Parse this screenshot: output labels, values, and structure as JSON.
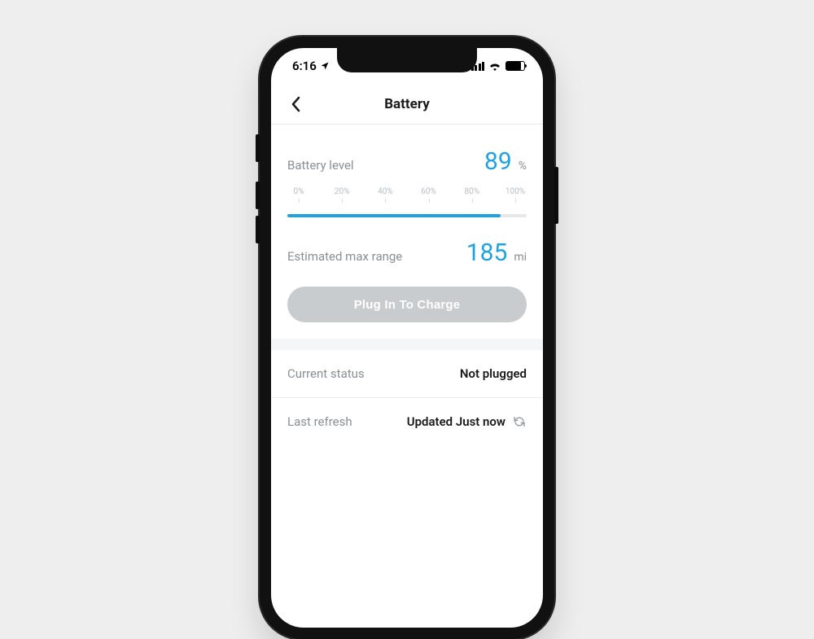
{
  "statusbar": {
    "time": "6:16",
    "battery_fill_pct": 80
  },
  "nav": {
    "title": "Battery"
  },
  "battery": {
    "level_label": "Battery level",
    "level_value": "89",
    "level_unit": "%",
    "level_pct": 89,
    "ticks": [
      "0%",
      "20%",
      "40%",
      "60%",
      "80%",
      "100%"
    ],
    "range_label": "Estimated max range",
    "range_value": "185",
    "range_unit": "mi",
    "charge_button": "Plug In To Charge"
  },
  "status": {
    "current_label": "Current status",
    "current_value": "Not plugged",
    "refresh_label": "Last refresh",
    "refresh_value": "Updated Just now"
  },
  "colors": {
    "accent": "#1fa3e0"
  }
}
